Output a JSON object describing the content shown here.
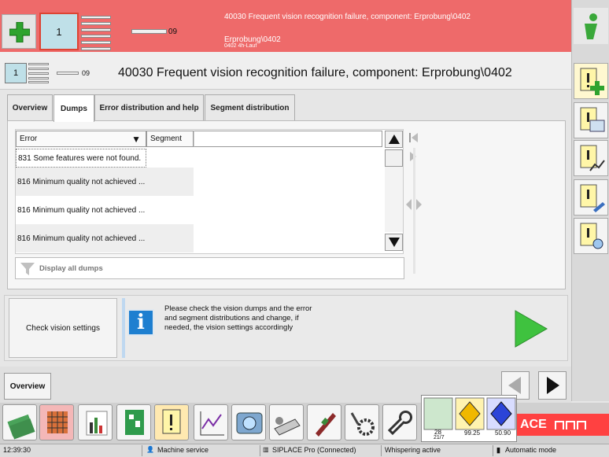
{
  "colors": {
    "alarm_bar": "#ee6a6a",
    "accent_green": "#2ea32e",
    "siplace_red": "#ff4141"
  },
  "alarm": {
    "card_number": "1",
    "counter": "09",
    "message": "40030 Frequent vision recognition failure, component: Erprobung\\0402",
    "component": "Erprobung\\0402",
    "component_sub": "0402 4h-Lauf"
  },
  "header": {
    "card_number": "1",
    "counter": "09",
    "title": "40030 Frequent vision recognition failure, component: Erprobung\\0402"
  },
  "tabs": [
    {
      "label": "Overview"
    },
    {
      "label": "Dumps"
    },
    {
      "label": "Error distribution and help"
    },
    {
      "label": "Segment distribution"
    }
  ],
  "table": {
    "columns": [
      "Error",
      "Segment"
    ],
    "rows": [
      "831 Some features were not found.",
      "816 Minimum quality not achieved ...",
      "816 Minimum quality not achieved ...",
      "816 Minimum quality not achieved ..."
    ],
    "filter_label": "Display all dumps"
  },
  "action": {
    "button_label": "Check vision settings",
    "info_text": "Please check the vision dumps and the error and segment distributions and change, if needed, the vision settings accordingly"
  },
  "bottom": {
    "overview_label": "Overview"
  },
  "gauges": {
    "values": [
      "28",
      "99.25",
      "50.90"
    ],
    "sub": "21/7"
  },
  "brand": "ACE",
  "status": {
    "time": "12:39:30",
    "mode1": "Machine service",
    "connection": "SIPLACE Pro (Connected)",
    "whisper": "Whispering active",
    "mode2": "Automatic mode"
  }
}
